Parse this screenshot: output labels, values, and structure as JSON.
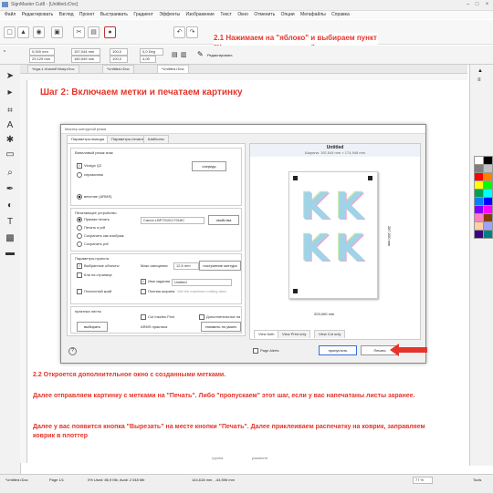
{
  "window": {
    "title": "SignMaster Cut8 - [Untitled.rDoc]",
    "controls": [
      "–",
      "□",
      "×"
    ]
  },
  "menu": [
    "Файл",
    "Редактировать",
    "Взгляд",
    "Проект",
    "Выстраивать",
    "Градиент",
    "Эффекты",
    "Изображение",
    "Текст",
    "Окно",
    "Отменить",
    "Опции",
    "Мегафайлы",
    "Справка"
  ],
  "toolbar": {
    "icons": [
      "new-icon",
      "open-icon",
      "save-icon",
      "print-icon",
      "cut-icon",
      "apple-icon",
      "undo-icon",
      "redo-icon"
    ],
    "edit_label": "Редактировать"
  },
  "propbar": {
    "x": "0,000 mm",
    "y": "29,129 mm",
    "w": "157,044 mm",
    "h": "180,949 mm",
    "scale_w": "100,0",
    "scale_h": "100,0",
    "angle": "0,0 Deg",
    "step": "4,05"
  },
  "doc_tabs": [
    "Yoga-1.rKanisEVitaly.rDoc",
    "*Untitled.rDoc",
    "*Untitled.rDoc"
  ],
  "step_header": "Шаг 2: Включаем метки и печатаем картинку",
  "callout_top": "2.1 Нажимаем на \"яблоко\" и выбираем пункт \"Контур вырезать мастер..\"",
  "dialog": {
    "title": "Мастер контурной резки",
    "tabs": [
      "Параметры вывода",
      "Параметры печати",
      "Шаблоны"
    ],
    "cutter_group": "Виниловый резак знак",
    "cutter_model": "Vicsign Q2",
    "queue_btn": "очередь",
    "help_link": "справочник",
    "send_option": "вечение (ARMS)",
    "printer_group": "Печатающее устройство",
    "print_options": [
      "Прямая печать",
      "Печать в pdf",
      "Сохранить как изображ",
      "Сохранить pdf"
    ],
    "printer_name": "Canon LBP7010C/7018C",
    "props_btn": "свойства",
    "project_group": "Параметры проекта",
    "selected_objects": "Выбранные объекты",
    "offset_label": "Макс смещения",
    "offset_value": "12,5 mm",
    "contour_btn": "построение контура",
    "fit_page": "Кли на странице",
    "job_name_label": "Имя задания",
    "job_name_value": "Untitled",
    "contour_cut": "Платочный край",
    "full_width": "Полная ширина",
    "full_width_hint": "Get the maximum cutting area",
    "sheet_group": "практика листы",
    "cut_inside": "Cut Insides First",
    "extra_params": "Дополнительные па",
    "choose_btn": "выбирать",
    "arms_label": "ARMS практика",
    "default_btn": "тановить по умолч",
    "preview_title": "Untitled",
    "preview_size": "Ширина: 192,544 mm × 174,948 mm",
    "dim_h": "203,000 mm",
    "dim_v": "287,000 mm",
    "view_tabs": [
      "View both",
      "View Print only",
      "View Cut only"
    ],
    "page_alerts": "Page Alerts",
    "skip_btn": "пропустить",
    "print_btn": "Печать",
    "help_icon": "?"
  },
  "text_block": {
    "line1": "2.2 Откроется дополнительное окно с созданными метками.",
    "line2": "Далее отправляем картинку с метками на \"Печать\".  Либо \"пропускаем\" этот шаг, если у вас напечатаны листы заранее.",
    "line3": "Далее у вас появится кнопка \"Вырезать\" на месте кнопки \"Печать\". Далее приклеиваем распечатку на коврик, заправляем коврик в плоттер"
  },
  "bottom_labels": [
    "группа",
    "размеяте"
  ],
  "statusbar": {
    "file": "*Untitled.rDoc",
    "page": "Page 1/1",
    "memory": "0%  Used: 86,9 Mb, Avail: 2 048 Mb",
    "coords": "144,618 mm , -44,596 mm",
    "zoom": "77 %",
    "tools": "Tools"
  },
  "colors": {
    "accent_red": "#e6342b",
    "swatches": [
      "#ffffff",
      "#000000",
      "#7f7f7f",
      "#c0c0c0",
      "#ff0000",
      "#ff8000",
      "#ffff00",
      "#00ff00",
      "#00a050",
      "#00ffff",
      "#0080ff",
      "#0000ff",
      "#8000ff",
      "#ff00ff",
      "#ff80c0",
      "#804000",
      "#ffd0a0",
      "#a0a0ff",
      "#400080",
      "#008080"
    ]
  }
}
